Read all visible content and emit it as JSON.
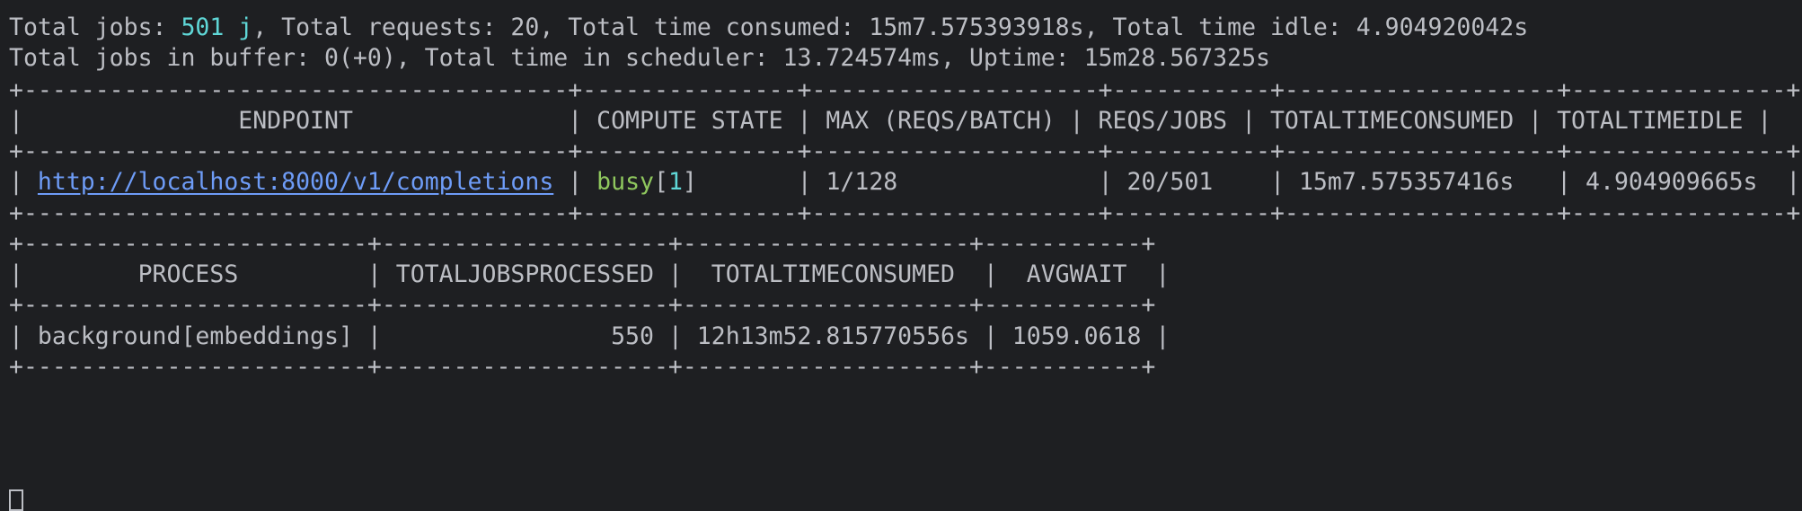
{
  "summary": {
    "line1_prefix": "Total jobs: ",
    "total_jobs_value": "501 j",
    "line1_suffix": ", Total requests: 20, Total time consumed: 15m7.575393918s, Total time idle: 4.904920042s",
    "line2": "Total jobs in buffer: 0(+0), Total time in scheduler: 13.724574ms, Uptime: 15m28.567325s"
  },
  "endpoint_table": {
    "border": "+--------------------------------------+---------------+--------------------+-----------+-------------------+---------------+",
    "header_text": "|               ENDPOINT               | COMPUTE STATE | MAX (REQS/BATCH) | REQS/JOBS | TOTALTIMECONSUMED | TOTALTIMEIDLE |",
    "row": {
      "lead": "| ",
      "endpoint_url": "http://localhost:8000/v1/completions",
      "sep1": " | ",
      "state": "busy",
      "state_bracket_open": "[",
      "state_count": "1",
      "state_bracket_close": "]",
      "rest": "       | 1/128              | 20/501    | 15m7.575357416s   | 4.904909665s  |"
    }
  },
  "process_table": {
    "border": "+------------------------+--------------------+--------------------+-----------+",
    "header_text": "|        PROCESS         | TOTALJOBSPROCESSED |  TOTALTIMECONSUMED  |  AVGWAIT  |",
    "row_text": "| background[embeddings] |                550 | 12h13m52.815770556s | 1059.0618 |"
  },
  "colors": {
    "background": "#1e1f22",
    "text": "#bcbec4",
    "cyan": "#5fd7d7",
    "green": "#8fc75e",
    "link": "#6e9cf7"
  }
}
